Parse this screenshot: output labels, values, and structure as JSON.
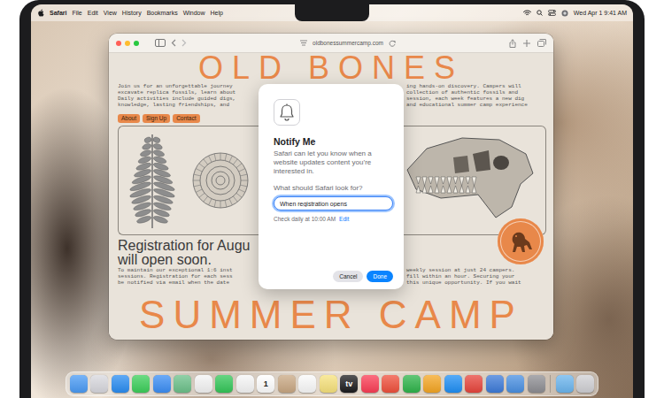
{
  "menu_bar": {
    "app_name": "Safari",
    "menus": [
      "File",
      "Edit",
      "View",
      "History",
      "Bookmarks",
      "Window",
      "Help"
    ],
    "clock": "Wed Apr 1 9:41 AM"
  },
  "browser": {
    "url": "oldbonessummercamp.com"
  },
  "page": {
    "title": "OLD BONES",
    "intro_left": [
      "Join us for an unforgettable journey",
      "excavate replica fossils, learn about",
      "Daily activities include guided digs,",
      "knowledge, lasting friendships, and"
    ],
    "intro_right": [
      "ing hands-on discovery. Campers will",
      "collection of authentic fossils and",
      "session, each week features a new dig",
      "and educational summer camp experience"
    ],
    "nav": [
      "About",
      "Sign Up",
      "Contact"
    ],
    "heading": [
      "Registration for Augu",
      "will open soon."
    ],
    "details_left": [
      "To maintain our exceptional 1:6 inst",
      "sessions. Registration for each sess",
      "be notified via email when the date"
    ],
    "details_right": [
      "weekly session at just 24 campers.",
      "fill within an hour. Securing your",
      "this unique opportunity. If you wait"
    ],
    "footer_title": "SUMMER CAMP"
  },
  "dialog": {
    "title": "Notify Me",
    "description": "Safari can let you know when a website updates content you’re interested in.",
    "prompt": "What should Safari look for?",
    "input_value": "When registration opens",
    "input_focused": true,
    "schedule": "Check daily at 10:00 AM",
    "edit_link": "Edit",
    "buttons": [
      {
        "label": "Cancel",
        "primary": false
      },
      {
        "label": "Done",
        "primary": true
      }
    ]
  },
  "dock": {
    "apps": [
      {
        "color": "#4a9bf5"
      },
      {
        "color": "#d8d8de"
      },
      {
        "color": "#2a8df2"
      },
      {
        "color": "#3ccf5a"
      },
      {
        "color": "#3b8ef5"
      },
      {
        "color": "#6cc18a"
      },
      {
        "color": "#f4f4f4"
      },
      {
        "color": "#34c759"
      },
      {
        "color": "#f6f6f6"
      },
      {
        "color": "#ffffff",
        "text": "1"
      },
      {
        "color": "#c9a883"
      },
      {
        "color": "#fafafa"
      },
      {
        "color": "#f7e27c"
      },
      {
        "color": "#1c1c1e",
        "text": "tv"
      },
      {
        "color": "#fb3d55"
      },
      {
        "color": "#f0503c"
      },
      {
        "color": "#2fb44a"
      },
      {
        "color": "#f5a623"
      },
      {
        "color": "#1f8ff5"
      },
      {
        "color": "#e8453c"
      },
      {
        "color": "#3d7bd9"
      },
      {
        "color": "#4a90e2"
      },
      {
        "color": "#8e8e93"
      }
    ],
    "others": [
      {
        "color": "#6bb5ee"
      },
      {
        "color": "#d0d0d4"
      }
    ]
  }
}
